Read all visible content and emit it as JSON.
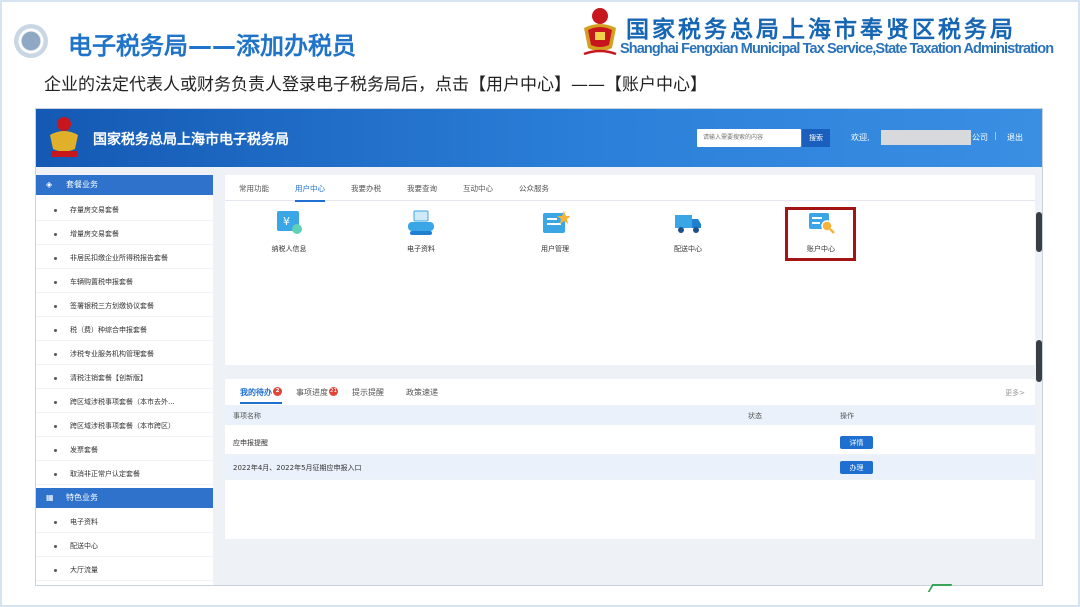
{
  "slide": {
    "title": "电子税务局——添加办税员",
    "org_cn": "国家税务总局上海市奉贤区税务局",
    "org_en": "Shanghai Fengxian Municipal Tax Service,State Taxation Administration",
    "instruction": "企业的法定代表人或财务负责人登录电子税务局后，点击【用户中心】——【账户中心】"
  },
  "header": {
    "site_title": "国家税务总局上海市电子税务局",
    "search_placeholder": "请输入需要搜索的内容",
    "search_label": "搜索",
    "welcome": "欢迎,",
    "center_link": "公司",
    "separator": "|",
    "logout": "退出"
  },
  "sidebar": {
    "section1": "套餐业务",
    "items1": [
      "存量房交易套餐",
      "增量房交易套餐",
      "非居民扣缴企业所得税报告套餐",
      "车辆购置税申报套餐",
      "签署银税三方划缴协议套餐",
      "税（费）种综合申报套餐",
      "涉税专业服务机构管理套餐",
      "清税注销套餐【创新版】",
      "跨区域涉税事项套餐（本市去外...",
      "跨区域涉税事项套餐（本市跨区）",
      "发票套餐",
      "取消非正常户认定套餐"
    ],
    "section2": "特色业务",
    "items2": [
      "电子资料",
      "配送中心",
      "大厅流量"
    ]
  },
  "tabs": [
    "常用功能",
    "用户中心",
    "我要办税",
    "我要查询",
    "互动中心",
    "公众服务"
  ],
  "functions": [
    "纳税人信息",
    "电子资料",
    "用户管理",
    "配送中心",
    "账户中心"
  ],
  "todo": {
    "tabs": [
      "我的待办",
      "事项进度",
      "提示提醒",
      "政策速递"
    ],
    "badges": [
      "2",
      "21"
    ],
    "more": "更多>",
    "headers": [
      "事项名称",
      "状态",
      "操作"
    ],
    "rows": [
      {
        "name": "应申报提醒",
        "action": "详情"
      },
      {
        "name": "2022年4月、2022年5月征期应申报入口",
        "action": "办理"
      }
    ]
  },
  "colors": {
    "slide_title": "#1f73c8",
    "header_blue": "#2b7fd8",
    "highlight": "#a31515",
    "badge_red": "#e0453a"
  }
}
